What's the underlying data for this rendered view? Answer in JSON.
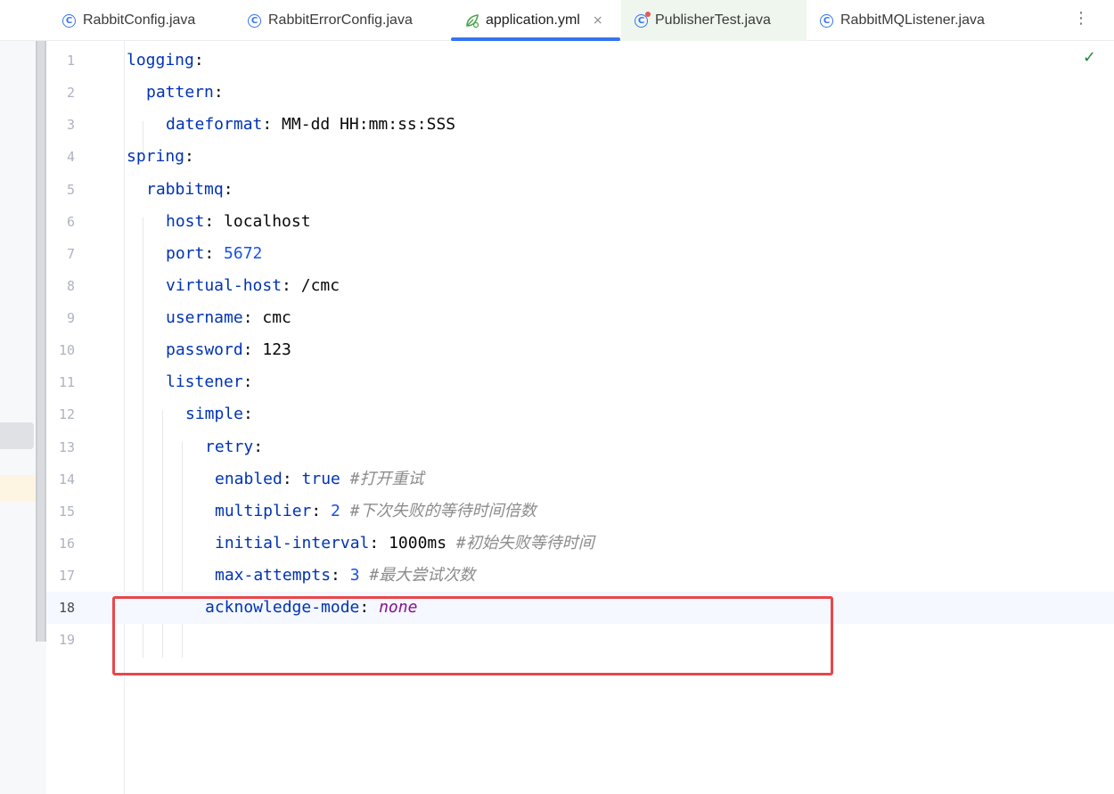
{
  "tabs": [
    {
      "label": "RabbitConfig.java",
      "icon": "class-icon"
    },
    {
      "label": "RabbitErrorConfig.java",
      "icon": "class-icon"
    },
    {
      "label": "application.yml",
      "icon": "spring-leaf-icon",
      "close": "×"
    },
    {
      "label": "PublisherTest.java",
      "icon": "test-class-icon"
    },
    {
      "label": "RabbitMQListener.java",
      "icon": "class-icon"
    }
  ],
  "more_label": "⋮",
  "status_icon": "✓",
  "lines": [
    {
      "n": "1",
      "key": "logging",
      "colon": ":",
      "val": "",
      "comment": ""
    },
    {
      "n": "2",
      "key": "pattern",
      "colon": ":",
      "val": "",
      "comment": ""
    },
    {
      "n": "3",
      "key": "dateformat",
      "colon": ":",
      "val": " MM-dd HH:mm:ss:SSS",
      "comment": ""
    },
    {
      "n": "4",
      "key": "spring",
      "colon": ":",
      "val": "",
      "comment": ""
    },
    {
      "n": "5",
      "key": "rabbitmq",
      "colon": ":",
      "val": "",
      "comment": ""
    },
    {
      "n": "6",
      "key": "host",
      "colon": ":",
      "val": " localhost",
      "comment": ""
    },
    {
      "n": "7",
      "key": "port",
      "colon": ":",
      "val": " 5672",
      "comment": ""
    },
    {
      "n": "8",
      "key": "virtual-host",
      "colon": ":",
      "val": " /cmc",
      "comment": ""
    },
    {
      "n": "9",
      "key": "username",
      "colon": ":",
      "val": " cmc",
      "comment": ""
    },
    {
      "n": "10",
      "key": "password",
      "colon": ":",
      "val": " 123",
      "comment": ""
    },
    {
      "n": "11",
      "key": "listener",
      "colon": ":",
      "val": "",
      "comment": ""
    },
    {
      "n": "12",
      "key": "simple",
      "colon": ":",
      "val": "",
      "comment": ""
    },
    {
      "n": "13",
      "key": "retry",
      "colon": ":",
      "val": "",
      "comment": ""
    },
    {
      "n": "14",
      "key": "enabled",
      "colon": ":",
      "val": " true",
      "comment": " #打开重试"
    },
    {
      "n": "15",
      "key": "multiplier",
      "colon": ":",
      "val": " 2",
      "comment": " #下次失败的等待时间倍数"
    },
    {
      "n": "16",
      "key": "initial-interval",
      "colon": ":",
      "val": " 1000ms",
      "comment": " #初始失败等待时间"
    },
    {
      "n": "17",
      "key": "max-attempts",
      "colon": ":",
      "val": " 3",
      "comment": " #最大尝试次数"
    },
    {
      "n": "18",
      "key": "acknowledge-mode",
      "colon": ":",
      "val": " none",
      "comment": ""
    },
    {
      "n": "19",
      "key": "",
      "colon": "",
      "val": "",
      "comment": ""
    }
  ]
}
